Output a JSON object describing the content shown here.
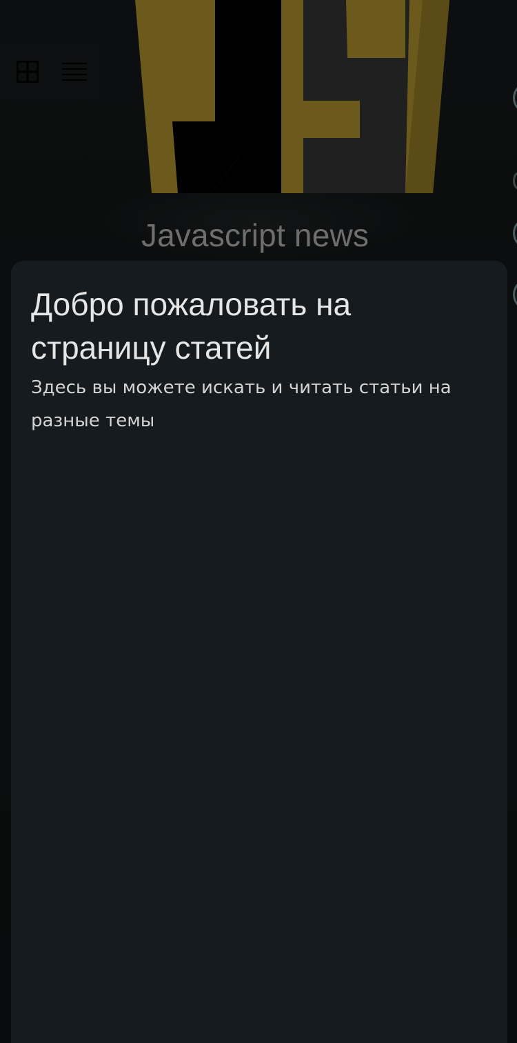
{
  "header": {
    "grid_icon": "grid-icon",
    "menu_icon": "hamburger-menu-icon",
    "logo": "js-logo",
    "title": "Javascript news"
  },
  "card": {
    "title": "Добро пожаловать на страницу статей",
    "subtitle": "Здесь вы можете искать и читать статьи на разные темы"
  },
  "colors": {
    "background": "#0b0d0e",
    "card": "#151b1e",
    "logo_gold": "#6b5a1c",
    "title_text": "#6e6e6e",
    "card_title_text": "#e6e6e6",
    "side_button_border": "#4b5c60"
  }
}
